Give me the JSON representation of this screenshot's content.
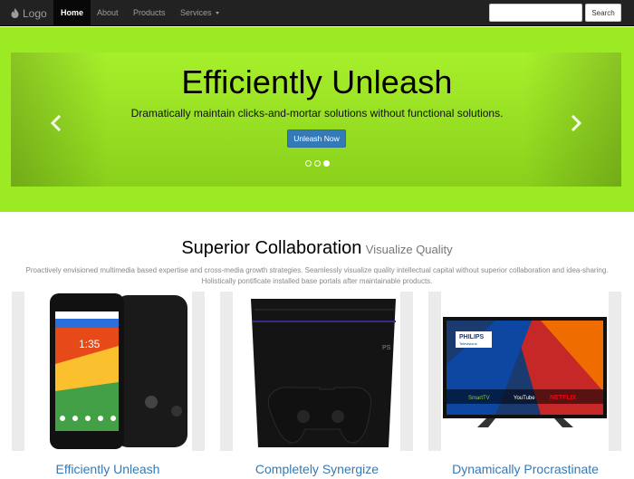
{
  "nav": {
    "brand": "Logo",
    "items": [
      {
        "label": "Home"
      },
      {
        "label": "About"
      },
      {
        "label": "Products"
      },
      {
        "label": "Services"
      }
    ],
    "search_placeholder": "",
    "search_button": "Search"
  },
  "hero": {
    "title": "Efficiently Unleash",
    "subtitle": "Dramatically maintain clicks-and-mortar solutions without functional solutions.",
    "button": "Unleash Now",
    "background": "#9cea24",
    "active_slide": 3,
    "slide_count": 3
  },
  "section": {
    "title": "Superior Collaboration",
    "subtitle": "Visualize Quality",
    "description_line1": "Proactively envisioned multimedia based expertise and cross-media growth strategies. Seamlessly visualize quality intellectual capital without superior collaboration and idea-sharing.",
    "description_line2": "Holistically pontificate installed base portals after maintainable products."
  },
  "products": [
    {
      "label": "Efficiently Unleash",
      "image": "smartphone-image"
    },
    {
      "label": "Completely Synergize",
      "image": "game-console-image"
    },
    {
      "label": "Dynamically Procrastinate",
      "image": "smart-tv-image"
    }
  ],
  "tv_screen": {
    "brand": "PHILIPS",
    "brand_sub": "Televisions",
    "apps": [
      "SmartTV",
      "YouTube",
      "NETFLIX"
    ]
  },
  "colors": {
    "accent": "#337ab7",
    "navbar": "#222222"
  }
}
